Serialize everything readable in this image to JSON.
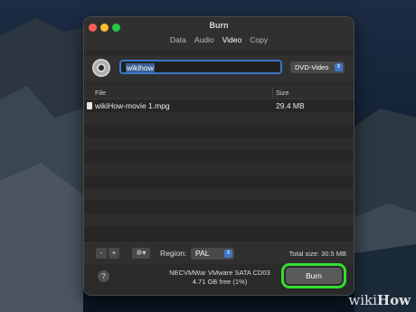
{
  "window": {
    "title": "Burn",
    "tabs": [
      {
        "label": "Data"
      },
      {
        "label": "Audio"
      },
      {
        "label": "Video"
      },
      {
        "label": "Copy"
      }
    ]
  },
  "disc": {
    "name_value": "wikihow",
    "format_value": "DVD-Video"
  },
  "table": {
    "headers": {
      "file": "File",
      "size": "Size"
    },
    "rows": [
      {
        "file": "wikiHow-movie 1.mpg",
        "size": "29.4 MB"
      }
    ]
  },
  "controls": {
    "minus_label": "-",
    "plus_label": "+",
    "gear_label": "✲▾",
    "region_label": "Region:",
    "region_value": "PAL",
    "total_size": "Total size: 30.5 MB"
  },
  "footer": {
    "help_label": "?",
    "device_name": "NECVMWar VMware SATA CD03",
    "device_free": "4.71 GB free (1%)",
    "burn_label": "Burn"
  },
  "watermark": {
    "wiki": "wiki",
    "how": "How"
  },
  "colors": {
    "highlight": "#33dd33",
    "accent": "#3b78c4"
  }
}
